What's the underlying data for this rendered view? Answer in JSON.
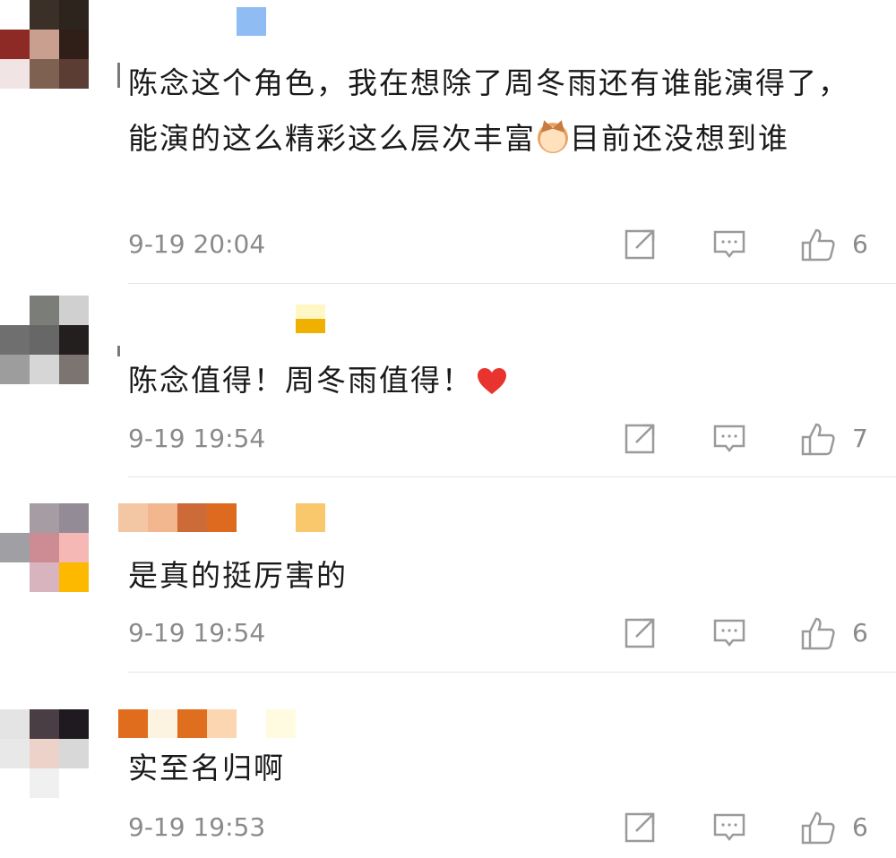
{
  "comments": [
    {
      "text_parts": [
        "陈念这个角色，我在想除了周冬雨还有谁能演得了，能演的这么精彩这么层次丰富",
        "目前还没想到谁"
      ],
      "emoji": "cat-face-emoji",
      "time": "9-19 20:04",
      "likes": "6"
    },
    {
      "text_parts": [
        "陈念值得！周冬雨值得！"
      ],
      "emoji": "red-heart-emoji",
      "time": "9-19 19:54",
      "likes": "7"
    },
    {
      "text_parts": [
        "是真的挺厉害的"
      ],
      "time": "9-19 19:54",
      "likes": "6"
    },
    {
      "text_parts": [
        "实至名归啊"
      ],
      "time": "9-19 19:53",
      "likes": "6"
    }
  ],
  "icons": {
    "share": "share-icon",
    "reply": "comment-icon",
    "like": "thumbs-up-icon"
  },
  "colors": {
    "text": "#1a1a1a",
    "meta": "#8a8a8a",
    "divider": "#e6e6e6",
    "icon": "#9a9a9a"
  }
}
